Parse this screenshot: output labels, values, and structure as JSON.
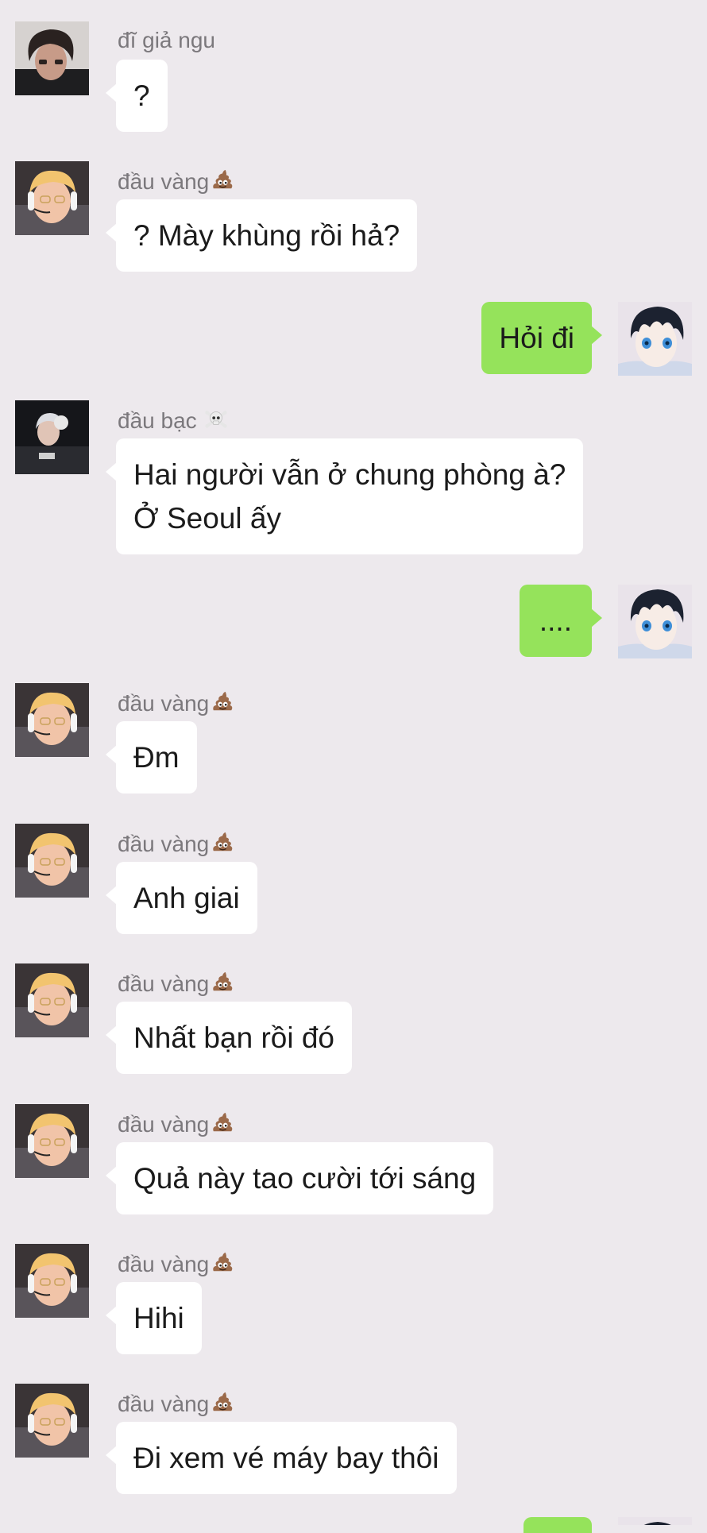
{
  "colors": {
    "background": "#ede9ed",
    "incoming_bubble": "#ffffff",
    "outgoing_bubble": "#95e35b",
    "name_text": "#7b787c"
  },
  "messages": [
    {
      "sender": "đĩ giả ngu",
      "text": "?",
      "direction": "incoming",
      "avatar": "guy-dark-hair-avatar"
    },
    {
      "sender": "đầu vàng",
      "sender_emoji": "poop-emoji-icon",
      "text": "? Mày khùng rồi hả?",
      "direction": "incoming",
      "avatar": "blond-headset-avatar"
    },
    {
      "text": "Hỏi đi",
      "direction": "outgoing",
      "avatar": "anime-boy-avatar"
    },
    {
      "sender": "đầu bạc",
      "sender_emoji": "skull-crossbones-emoji-icon",
      "text_line1": "Hai người vẫn ở chung phòng à?",
      "text_line2": "Ở Seoul ấy",
      "direction": "incoming",
      "avatar": "silver-hair-avatar"
    },
    {
      "text": "....",
      "direction": "outgoing",
      "avatar": "anime-boy-avatar"
    },
    {
      "sender": "đầu vàng",
      "sender_emoji": "poop-emoji-icon",
      "text": "Đm",
      "direction": "incoming",
      "avatar": "blond-headset-avatar"
    },
    {
      "sender": "đầu vàng",
      "sender_emoji": "poop-emoji-icon",
      "text": "Anh giai",
      "direction": "incoming",
      "avatar": "blond-headset-avatar"
    },
    {
      "sender": "đầu vàng",
      "sender_emoji": "poop-emoji-icon",
      "text": "Nhất bạn rồi đó",
      "direction": "incoming",
      "avatar": "blond-headset-avatar"
    },
    {
      "sender": "đầu vàng",
      "sender_emoji": "poop-emoji-icon",
      "text": "Quả này tao cười tới sáng",
      "direction": "incoming",
      "avatar": "blond-headset-avatar"
    },
    {
      "sender": "đầu vàng",
      "sender_emoji": "poop-emoji-icon",
      "text": "Hihi",
      "direction": "incoming",
      "avatar": "blond-headset-avatar"
    },
    {
      "sender": "đầu vàng",
      "sender_emoji": "poop-emoji-icon",
      "text": "Đi xem vé máy bay thôi",
      "direction": "incoming",
      "avatar": "blond-headset-avatar"
    }
  ]
}
